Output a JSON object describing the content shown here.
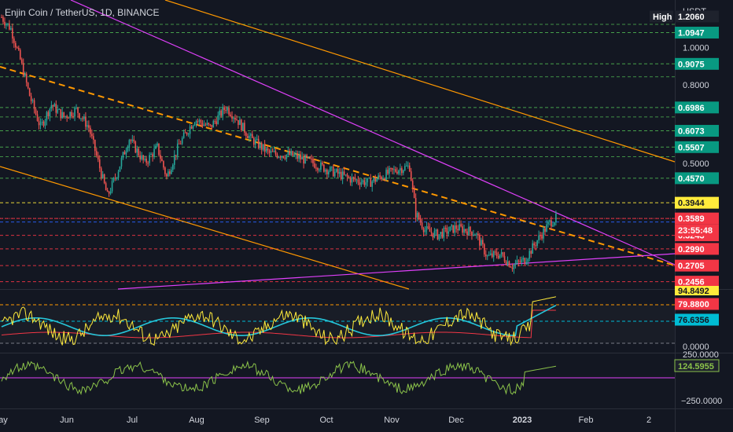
{
  "header": {
    "title": "Enjin Coin / TetherUS, 1D, BINANCE"
  },
  "chart_data": {
    "type": "candlestick",
    "title": "Enjin Coin / TetherUS, 1D, BINANCE",
    "y_unit": "USDT",
    "y_scale": "log",
    "ylim": [
      0.235,
      1.27
    ],
    "grid": false,
    "x_ticks": [
      "ay",
      "Jun",
      "Jul",
      "Aug",
      "Sep",
      "Oct",
      "Nov",
      "Dec",
      "2023",
      "Feb",
      "2"
    ],
    "y_ticks": [
      1.0,
      0.8,
      0.5
    ],
    "close_path_approx": [
      [
        0,
        1.2
      ],
      [
        6,
        1.12
      ],
      [
        12,
        0.93
      ],
      [
        18,
        0.75
      ],
      [
        25,
        0.62
      ],
      [
        32,
        0.71
      ],
      [
        40,
        0.66
      ],
      [
        48,
        0.69
      ],
      [
        56,
        0.62
      ],
      [
        64,
        0.47
      ],
      [
        68,
        0.41
      ],
      [
        74,
        0.47
      ],
      [
        82,
        0.58
      ],
      [
        92,
        0.5
      ],
      [
        100,
        0.55
      ],
      [
        106,
        0.46
      ],
      [
        114,
        0.56
      ],
      [
        124,
        0.65
      ],
      [
        134,
        0.62
      ],
      [
        144,
        0.7
      ],
      [
        150,
        0.66
      ],
      [
        160,
        0.58
      ],
      [
        172,
        0.53
      ],
      [
        186,
        0.525
      ],
      [
        198,
        0.505
      ],
      [
        210,
        0.48
      ],
      [
        224,
        0.455
      ],
      [
        236,
        0.445
      ],
      [
        248,
        0.47
      ],
      [
        256,
        0.485
      ],
      [
        262,
        0.49
      ],
      [
        266,
        0.37
      ],
      [
        272,
        0.335
      ],
      [
        280,
        0.325
      ],
      [
        292,
        0.34
      ],
      [
        304,
        0.33
      ],
      [
        312,
        0.285
      ],
      [
        320,
        0.29
      ],
      [
        328,
        0.27
      ],
      [
        336,
        0.28
      ],
      [
        344,
        0.315
      ],
      [
        352,
        0.35
      ],
      [
        356,
        0.3589
      ]
    ],
    "price_levels": [
      {
        "label": "High",
        "value": 1.206,
        "color": "#1e222d",
        "line": "none"
      },
      {
        "label": "1.0947",
        "value": 1.0947,
        "color": "#089981",
        "line": "green"
      },
      {
        "label": "0.9075",
        "value": 0.9075,
        "color": "#089981",
        "line": "green"
      },
      {
        "label": "0.6986",
        "value": 0.6986,
        "color": "#089981",
        "line": "green"
      },
      {
        "label": "0.6073",
        "value": 0.6073,
        "color": "#089981",
        "line": "green"
      },
      {
        "label": "0.5507",
        "value": 0.5507,
        "color": "#089981",
        "line": "green"
      },
      {
        "label": "0.4570",
        "value": 0.457,
        "color": "#089981",
        "line": "green"
      },
      {
        "label": "0.3944",
        "value": 0.3944,
        "color": "#ffeb3b",
        "line": "yellow"
      },
      {
        "label": "0.3589",
        "value": 0.3589,
        "color": "#f23645",
        "line": "red"
      },
      {
        "label": "0.3515",
        "value": 0.3515,
        "color": "#2962ff",
        "line": "blue"
      },
      {
        "label": "0.3243",
        "value": 0.3243,
        "color": "#f23645",
        "line": "red"
      },
      {
        "label": "0.2990",
        "value": 0.299,
        "color": "#f23645",
        "line": "red"
      },
      {
        "label": "0.2705",
        "value": 0.2705,
        "color": "#f23645",
        "line": "red"
      },
      {
        "label": "0.2456",
        "value": 0.2456,
        "color": "#f23645",
        "line": "red"
      }
    ],
    "extra_green_lines": [
      1.15,
      0.84,
      0.66,
      0.52
    ],
    "last_price": {
      "value": 0.3589,
      "countdown": "23:55:48",
      "high_value": "1.2060"
    },
    "oscillator": {
      "labels": [
        "94.8492",
        "79.8800",
        "76.6356",
        "0.0000"
      ],
      "levels": [
        80,
        50,
        10
      ]
    },
    "cci": {
      "labels": [
        "250.0000",
        "124.5955",
        "−250.0000"
      ]
    }
  }
}
